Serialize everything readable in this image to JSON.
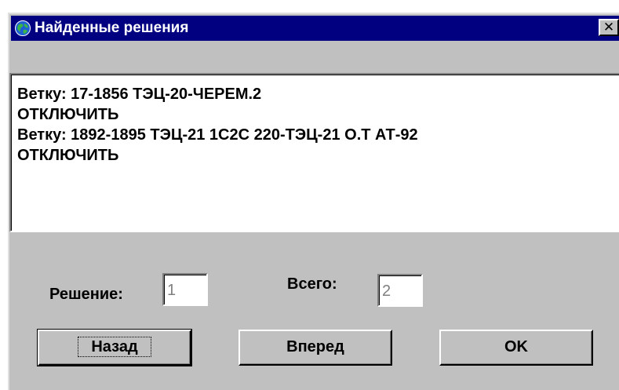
{
  "window": {
    "title": "Найденные решения",
    "close_glyph": "✕"
  },
  "solution_text": {
    "lines": [
      "Ветку: 17-1856 ТЭЦ-20-ЧЕРЕМ.2",
      "ОТКЛЮЧИТЬ",
      "Ветку: 1892-1895 ТЭЦ-21 1С2С 220-ТЭЦ-21 О.Т АТ-92",
      "ОТКЛЮЧИТЬ"
    ]
  },
  "counter": {
    "solution_label": "Решение:",
    "solution_value": "1",
    "total_label": "Всего:",
    "total_value": "2"
  },
  "buttons": {
    "back": "Назад",
    "forward": "Вперед",
    "ok": "OK"
  },
  "colors": {
    "titlebar": "#000080",
    "face": "#c0c0c0"
  }
}
